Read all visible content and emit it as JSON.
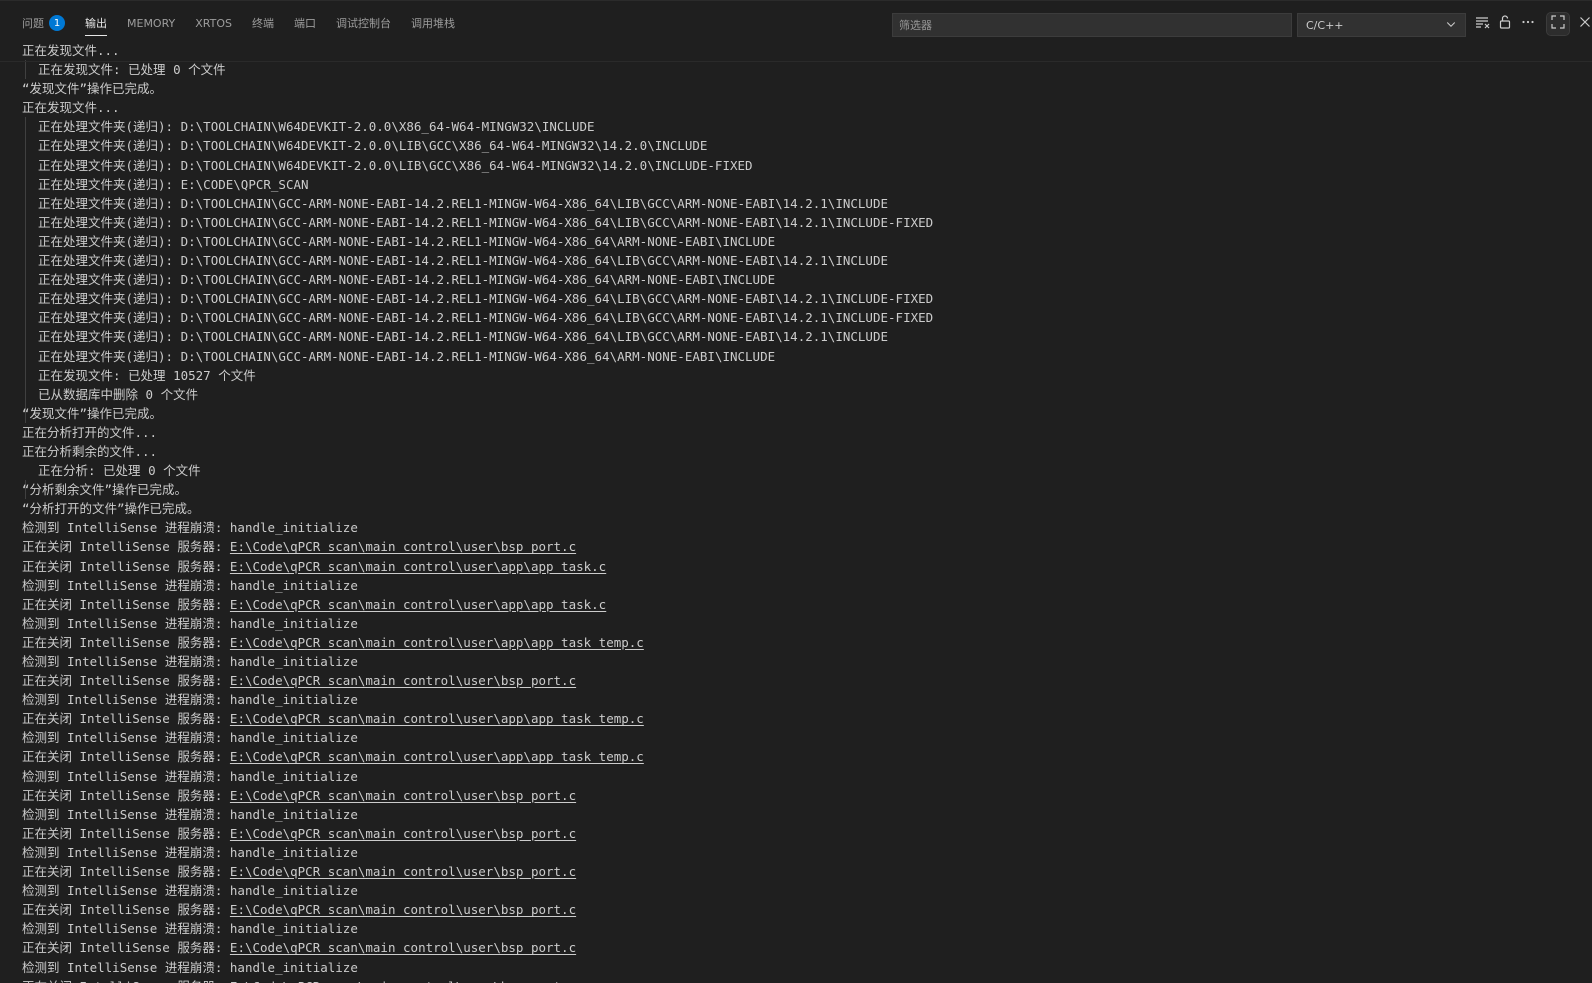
{
  "tabs": [
    {
      "label": "问题",
      "badge": "1"
    },
    {
      "label": "输出",
      "active": true
    },
    {
      "label": "MEMORY"
    },
    {
      "label": "XRTOS"
    },
    {
      "label": "终端"
    },
    {
      "label": "端口"
    },
    {
      "label": "调试控制台"
    },
    {
      "label": "调用堆栈"
    }
  ],
  "toolbar": {
    "filter_placeholder": "筛选器",
    "channel_value": "C/C++"
  },
  "icons": {
    "channel_dropdown": "chevron-down-icon",
    "clear": "clear-output-icon",
    "lock": "unlock-icon",
    "more": "ellipsis-icon",
    "maximize": "maximize-icon",
    "close": "close-icon"
  },
  "colors": {
    "background": "#1f1f1f",
    "text": "#cccccc",
    "badge": "#0078d4"
  },
  "output_lines": [
    {
      "text": "正在发现文件..."
    },
    {
      "text": "正在发现文件: 已处理 0 个文件",
      "indent": true
    },
    {
      "text": "“发现文件”操作已完成。"
    },
    {
      "text": "正在发现文件..."
    },
    {
      "text": "正在处理文件夹(递归): D:\\TOOLCHAIN\\W64DEVKIT-2.0.0\\X86_64-W64-MINGW32\\INCLUDE",
      "indent": true
    },
    {
      "text": "正在处理文件夹(递归): D:\\TOOLCHAIN\\W64DEVKIT-2.0.0\\LIB\\GCC\\X86_64-W64-MINGW32\\14.2.0\\INCLUDE",
      "indent": true
    },
    {
      "text": "正在处理文件夹(递归): D:\\TOOLCHAIN\\W64DEVKIT-2.0.0\\LIB\\GCC\\X86_64-W64-MINGW32\\14.2.0\\INCLUDE-FIXED",
      "indent": true
    },
    {
      "text": "正在处理文件夹(递归): E:\\CODE\\QPCR_SCAN",
      "indent": true
    },
    {
      "text": "正在处理文件夹(递归): D:\\TOOLCHAIN\\GCC-ARM-NONE-EABI-14.2.REL1-MINGW-W64-X86_64\\LIB\\GCC\\ARM-NONE-EABI\\14.2.1\\INCLUDE",
      "indent": true
    },
    {
      "text": "正在处理文件夹(递归): D:\\TOOLCHAIN\\GCC-ARM-NONE-EABI-14.2.REL1-MINGW-W64-X86_64\\LIB\\GCC\\ARM-NONE-EABI\\14.2.1\\INCLUDE-FIXED",
      "indent": true
    },
    {
      "text": "正在处理文件夹(递归): D:\\TOOLCHAIN\\GCC-ARM-NONE-EABI-14.2.REL1-MINGW-W64-X86_64\\ARM-NONE-EABI\\INCLUDE",
      "indent": true
    },
    {
      "text": "正在处理文件夹(递归): D:\\TOOLCHAIN\\GCC-ARM-NONE-EABI-14.2.REL1-MINGW-W64-X86_64\\LIB\\GCC\\ARM-NONE-EABI\\14.2.1\\INCLUDE",
      "indent": true
    },
    {
      "text": "正在处理文件夹(递归): D:\\TOOLCHAIN\\GCC-ARM-NONE-EABI-14.2.REL1-MINGW-W64-X86_64\\ARM-NONE-EABI\\INCLUDE",
      "indent": true
    },
    {
      "text": "正在处理文件夹(递归): D:\\TOOLCHAIN\\GCC-ARM-NONE-EABI-14.2.REL1-MINGW-W64-X86_64\\LIB\\GCC\\ARM-NONE-EABI\\14.2.1\\INCLUDE-FIXED",
      "indent": true
    },
    {
      "text": "正在处理文件夹(递归): D:\\TOOLCHAIN\\GCC-ARM-NONE-EABI-14.2.REL1-MINGW-W64-X86_64\\LIB\\GCC\\ARM-NONE-EABI\\14.2.1\\INCLUDE-FIXED",
      "indent": true
    },
    {
      "text": "正在处理文件夹(递归): D:\\TOOLCHAIN\\GCC-ARM-NONE-EABI-14.2.REL1-MINGW-W64-X86_64\\LIB\\GCC\\ARM-NONE-EABI\\14.2.1\\INCLUDE",
      "indent": true
    },
    {
      "text": "正在处理文件夹(递归): D:\\TOOLCHAIN\\GCC-ARM-NONE-EABI-14.2.REL1-MINGW-W64-X86_64\\ARM-NONE-EABI\\INCLUDE",
      "indent": true
    },
    {
      "text": "正在发现文件: 已处理 10527 个文件",
      "indent": true
    },
    {
      "text": "已从数据库中删除 0 个文件",
      "indent": true
    },
    {
      "text": "“发现文件”操作已完成。"
    },
    {
      "text": "正在分析打开的文件..."
    },
    {
      "text": "正在分析剩余的文件..."
    },
    {
      "text": "正在分析: 已处理 0 个文件",
      "indent": true
    },
    {
      "text": "“分析剩余文件”操作已完成。"
    },
    {
      "text": "“分析打开的文件”操作已完成。"
    },
    {
      "text": "检测到 IntelliSense 进程崩溃: handle_initialize"
    },
    {
      "text": "正在关闭 IntelliSense 服务器: ",
      "link": "E:\\Code\\qPCR_scan\\main_control\\user\\bsp_port.c"
    },
    {
      "text": "正在关闭 IntelliSense 服务器: ",
      "link": "E:\\Code\\qPCR_scan\\main_control\\user\\app\\app_task.c"
    },
    {
      "text": "检测到 IntelliSense 进程崩溃: handle_initialize"
    },
    {
      "text": "正在关闭 IntelliSense 服务器: ",
      "link": "E:\\Code\\qPCR_scan\\main_control\\user\\app\\app_task.c"
    },
    {
      "text": "检测到 IntelliSense 进程崩溃: handle_initialize"
    },
    {
      "text": "正在关闭 IntelliSense 服务器: ",
      "link": "E:\\Code\\qPCR_scan\\main_control\\user\\app\\app_task_temp.c"
    },
    {
      "text": "检测到 IntelliSense 进程崩溃: handle_initialize"
    },
    {
      "text": "正在关闭 IntelliSense 服务器: ",
      "link": "E:\\Code\\qPCR_scan\\main_control\\user\\bsp_port.c"
    },
    {
      "text": "检测到 IntelliSense 进程崩溃: handle_initialize"
    },
    {
      "text": "正在关闭 IntelliSense 服务器: ",
      "link": "E:\\Code\\qPCR_scan\\main_control\\user\\app\\app_task_temp.c"
    },
    {
      "text": "检测到 IntelliSense 进程崩溃: handle_initialize"
    },
    {
      "text": "正在关闭 IntelliSense 服务器: ",
      "link": "E:\\Code\\qPCR_scan\\main_control\\user\\app\\app_task_temp.c"
    },
    {
      "text": "检测到 IntelliSense 进程崩溃: handle_initialize"
    },
    {
      "text": "正在关闭 IntelliSense 服务器: ",
      "link": "E:\\Code\\qPCR_scan\\main_control\\user\\bsp_port.c"
    },
    {
      "text": "检测到 IntelliSense 进程崩溃: handle_initialize"
    },
    {
      "text": "正在关闭 IntelliSense 服务器: ",
      "link": "E:\\Code\\qPCR_scan\\main_control\\user\\bsp_port.c"
    },
    {
      "text": "检测到 IntelliSense 进程崩溃: handle_initialize"
    },
    {
      "text": "正在关闭 IntelliSense 服务器: ",
      "link": "E:\\Code\\qPCR_scan\\main_control\\user\\bsp_port.c"
    },
    {
      "text": "检测到 IntelliSense 进程崩溃: handle_initialize"
    },
    {
      "text": "正在关闭 IntelliSense 服务器: ",
      "link": "E:\\Code\\qPCR_scan\\main_control\\user\\bsp_port.c"
    },
    {
      "text": "检测到 IntelliSense 进程崩溃: handle_initialize"
    },
    {
      "text": "正在关闭 IntelliSense 服务器: ",
      "link": "E:\\Code\\qPCR_scan\\main_control\\user\\bsp_port.c"
    },
    {
      "text": "检测到 IntelliSense 进程崩溃: handle_initialize"
    },
    {
      "text": "正在关闭 IntelliSense 服务器: ",
      "link": "E:\\Code\\qPCR_scan\\main_control\\user\\bsp_port.c"
    }
  ]
}
